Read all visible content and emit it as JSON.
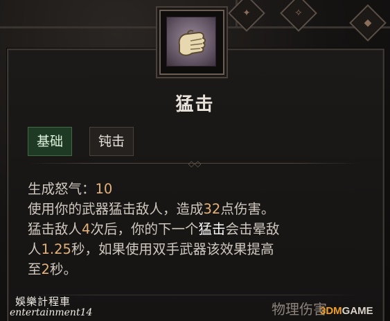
{
  "skill": {
    "name": "猛击",
    "tags": [
      "基础",
      "钝击"
    ],
    "icon": "fist-icon"
  },
  "description": {
    "resource_label": "生成怒气：",
    "resource_value": "10",
    "line2_a": "使用你的武器猛击敌人，造成",
    "line2_num": "32",
    "line2_b": "点伤害。",
    "line3_a": "猛击敌人",
    "line3_num": "4",
    "line3_b": "次后，你的下一个",
    "line3_kw": "猛击",
    "line3_c": "会击晕敌",
    "line4_a": "人",
    "line4_num": "1.25",
    "line4_b": "秒，如果使用双手武器该效果提高",
    "line5_a": "至",
    "line5_num": "2",
    "line5_b": "秒。"
  },
  "damage_type": "物理伤害",
  "watermark": {
    "cn": "娛樂計程車",
    "en": "entertainment14",
    "logo_a": "3DM",
    "logo_b": "GAME"
  },
  "colors": {
    "highlight_number": "#e3b27a",
    "basic_tag_bg": "#1f3a24"
  }
}
